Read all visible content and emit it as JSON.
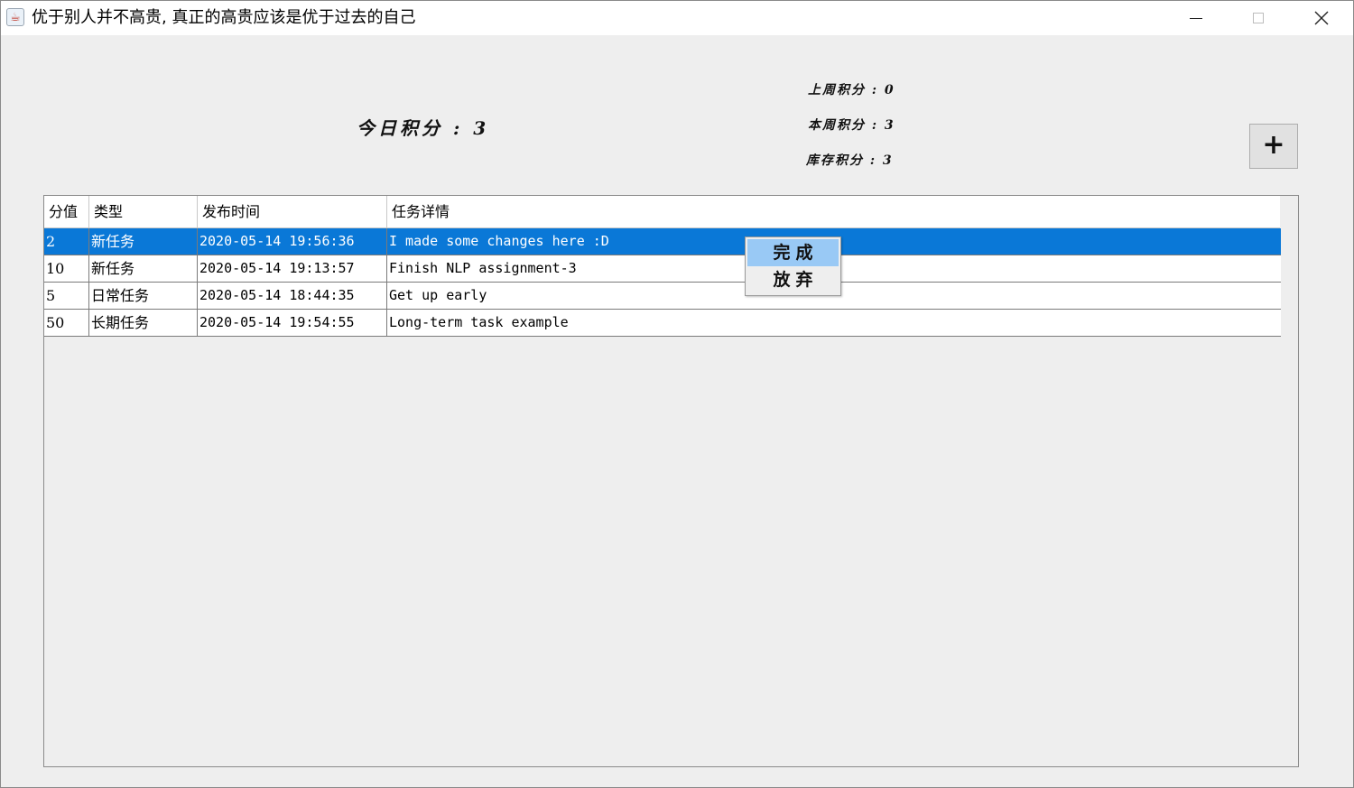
{
  "window": {
    "title": "优于别人并不高贵, 真正的高贵应该是优于过去的自己",
    "icon": "java-cup-icon"
  },
  "scores": {
    "today": "今日积分 : 3",
    "last_week": "上周积分 : 0",
    "this_week": "本周积分 : 3",
    "stock": "库存积分 : 3"
  },
  "toolbar": {
    "add_label": "+"
  },
  "table": {
    "columns": [
      "分值",
      "类型",
      "发布时间",
      "任务详情"
    ],
    "rows": [
      {
        "score": "2",
        "type": "新任务",
        "time": "2020-05-14 19:56:36",
        "detail": "I made some changes here :D",
        "selected": true
      },
      {
        "score": "10",
        "type": "新任务",
        "time": "2020-05-14 19:13:57",
        "detail": "Finish NLP assignment-3"
      },
      {
        "score": "5",
        "type": "日常任务",
        "time": "2020-05-14 18:44:35",
        "detail": "Get up early"
      },
      {
        "score": "50",
        "type": "长期任务",
        "time": "2020-05-14 19:54:55",
        "detail": "Long-term task example"
      }
    ]
  },
  "context_menu": {
    "complete": "完成",
    "abandon": "放弃"
  },
  "colors": {
    "selection": "#0a78d7",
    "menu_highlight": "#99c9f5",
    "window_bg": "#eeeeee"
  }
}
